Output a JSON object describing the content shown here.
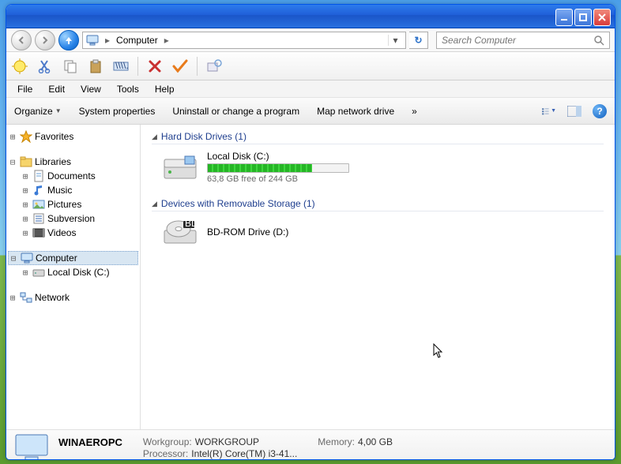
{
  "breadcrumb": {
    "root": "Computer"
  },
  "search": {
    "placeholder": "Search Computer"
  },
  "menus": {
    "file": "File",
    "edit": "Edit",
    "view": "View",
    "tools": "Tools",
    "help": "Help"
  },
  "cmds": {
    "organize": "Organize",
    "sysprops": "System properties",
    "uninstall": "Uninstall or change a program",
    "mapdrive": "Map network drive",
    "overflow": "»"
  },
  "tree": {
    "favorites": "Favorites",
    "libraries": "Libraries",
    "documents": "Documents",
    "music": "Music",
    "pictures": "Pictures",
    "subversion": "Subversion",
    "videos": "Videos",
    "computer": "Computer",
    "localdisk": "Local Disk (C:)",
    "network": "Network"
  },
  "groups": {
    "hdd": "Hard Disk Drives (1)",
    "removable": "Devices with Removable Storage (1)"
  },
  "drives": {
    "c": {
      "name": "Local Disk (C:)",
      "free": "63,8 GB free of 244 GB",
      "used_pct": 74
    },
    "d": {
      "name": "BD-ROM Drive (D:)"
    }
  },
  "details": {
    "name": "WINAEROPC",
    "workgroup_lbl": "Workgroup:",
    "workgroup": "WORKGROUP",
    "processor_lbl": "Processor:",
    "processor": "Intel(R) Core(TM) i3-41...",
    "memory_lbl": "Memory:",
    "memory": "4,00 GB"
  }
}
